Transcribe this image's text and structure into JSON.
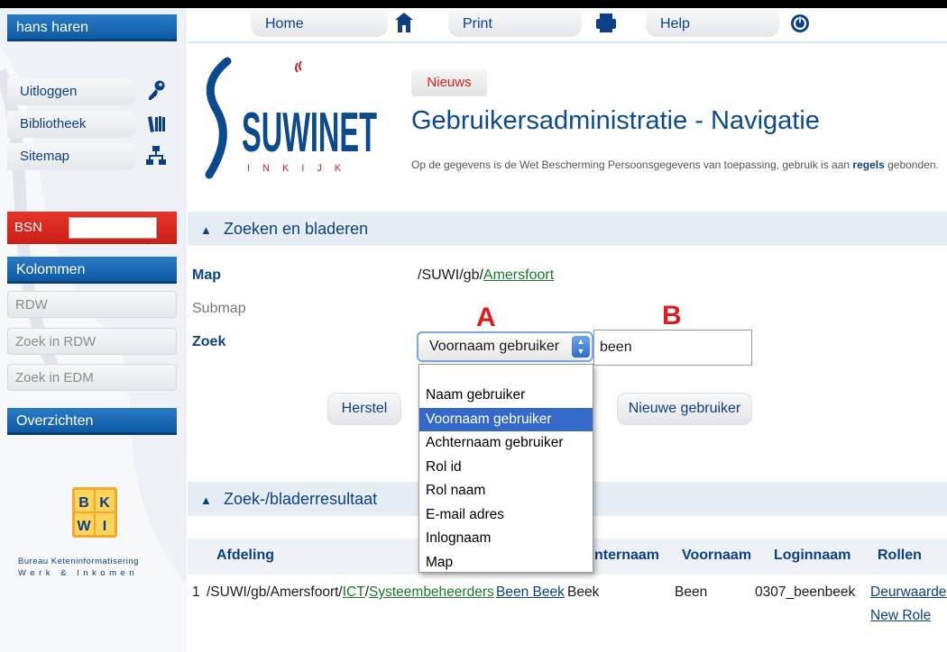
{
  "user": {
    "name": "hans haren"
  },
  "top_nav": [
    {
      "label": "Home",
      "icon": "house-icon"
    },
    {
      "label": "Print",
      "icon": "printer-icon"
    },
    {
      "label": "Help",
      "icon": "power-icon"
    }
  ],
  "sidebar": {
    "links": [
      {
        "label": "Uitloggen",
        "icon": "key-icon"
      },
      {
        "label": "Bibliotheek",
        "icon": "books-icon"
      },
      {
        "label": "Sitemap",
        "icon": "sitemap-icon"
      }
    ],
    "bsn_label": "BSN",
    "kolommen_title": "Kolommen",
    "kolommen_items": [
      "RDW",
      "Zoek in RDW",
      "Zoek in EDM"
    ],
    "overzichten_title": "Overzichten",
    "bkwi": {
      "logo_letters": [
        "B",
        "K",
        "W",
        "I"
      ],
      "line1": "Bureau Keteninformatisering",
      "line2": "Werk & Inkomen"
    }
  },
  "header": {
    "logo_text": "SUWINET",
    "logo_sub": "INKIJK",
    "news_label": "Nieuws",
    "title": "Gebruikersadministratie - Navigatie",
    "privacy_before": "Op de gegevens is de Wet Bescherming Persoonsgegevens van toepassing, gebruik is aan ",
    "privacy_link": "regels",
    "privacy_after": " gebonden."
  },
  "search_section": {
    "title": "Zoeken en bladeren",
    "map_label": "Map",
    "map_path_prefix": "/SUWI/gb/",
    "map_path_link": "Amersfoort",
    "submap_label": "Submap",
    "zoek_label": "Zoek",
    "select_value": "Voornaam gebruiker",
    "input_value": "been",
    "annotation_a": "A",
    "annotation_b": "B",
    "reset_label": "Herstel",
    "new_user_label": "Nieuwe gebruiker",
    "dropdown_options": [
      "Naam gebruiker",
      "Voornaam gebruiker",
      "Achternaam gebruiker",
      "Rol id",
      "Rol naam",
      "E-mail adres",
      "Inlognaam",
      "Map"
    ],
    "dropdown_selected_index": 1
  },
  "results_section": {
    "title": "Zoek-/bladerresultaat",
    "columns": [
      "Afdeling",
      "nternaam",
      "Voornaam",
      "Loginnaam",
      "Rollen"
    ],
    "rows": [
      {
        "index": "1",
        "afdeling_prefix": "/SUWI/gb/Amersfoort/",
        "afdeling_link1": "ICT",
        "afdeling_sep": "/",
        "afdeling_link2": "Systeembeheerders",
        "naam": "Been Beek",
        "achternaam": "Beek",
        "voornaam": "Been",
        "loginnaam": "0307_beenbeek",
        "rollen": [
          "Deurwaarder",
          "New Role"
        ]
      }
    ]
  },
  "colors": {
    "brand_blue": "#0b4a8f",
    "sidebar_header": "#1768b8",
    "bsn_red": "#d9251d",
    "annotation_red": "#e01b1b",
    "link_green": "#1a7a2a",
    "selected_option": "#3468c9"
  }
}
